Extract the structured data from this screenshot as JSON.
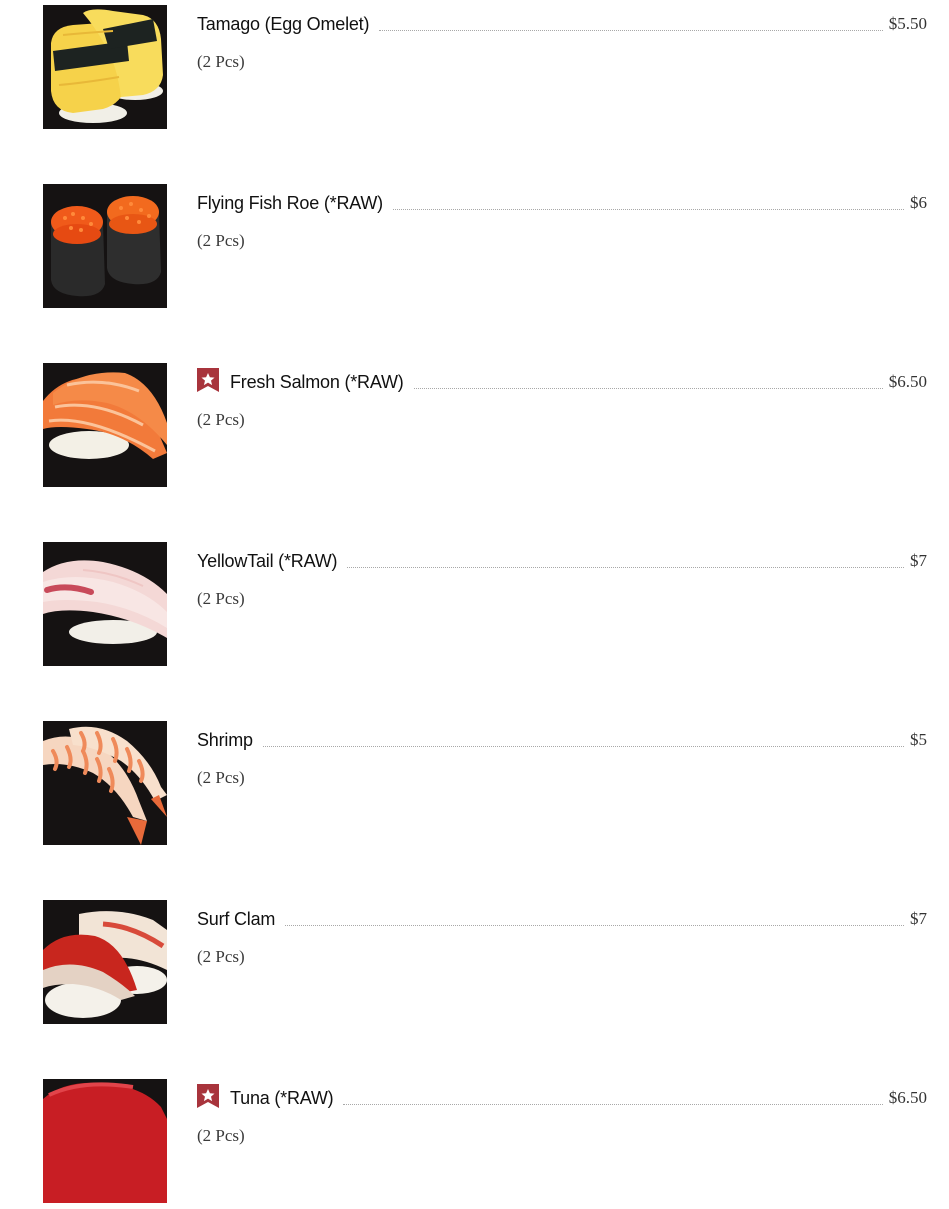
{
  "menu": {
    "items": [
      {
        "name": "Tamago (Egg Omelet)",
        "price": "$5.50",
        "desc": "(2 Pcs)",
        "featured": false,
        "image": "tamago-nigiri-image"
      },
      {
        "name": "Flying Fish Roe (*RAW)",
        "price": "$6",
        "desc": "(2 Pcs)",
        "featured": false,
        "image": "tobiko-gunkan-image"
      },
      {
        "name": "Fresh Salmon (*RAW)",
        "price": "$6.50",
        "desc": "(2 Pcs)",
        "featured": true,
        "image": "salmon-nigiri-image"
      },
      {
        "name": "YellowTail (*RAW)",
        "price": "$7",
        "desc": "(2 Pcs)",
        "featured": false,
        "image": "yellowtail-nigiri-image"
      },
      {
        "name": "Shrimp",
        "price": "$5",
        "desc": "(2 Pcs)",
        "featured": false,
        "image": "shrimp-nigiri-image"
      },
      {
        "name": "Surf Clam",
        "price": "$7",
        "desc": "(2 Pcs)",
        "featured": false,
        "image": "surf-clam-nigiri-image"
      },
      {
        "name": "Tuna (*RAW)",
        "price": "$6.50",
        "desc": "(2 Pcs)",
        "featured": true,
        "image": "tuna-nigiri-image"
      }
    ]
  },
  "icons": {
    "featured_badge": "star-bookmark-icon"
  },
  "colors": {
    "badge": "#a8343c",
    "image_background": "#151212",
    "leader": "#a8a8a8"
  }
}
